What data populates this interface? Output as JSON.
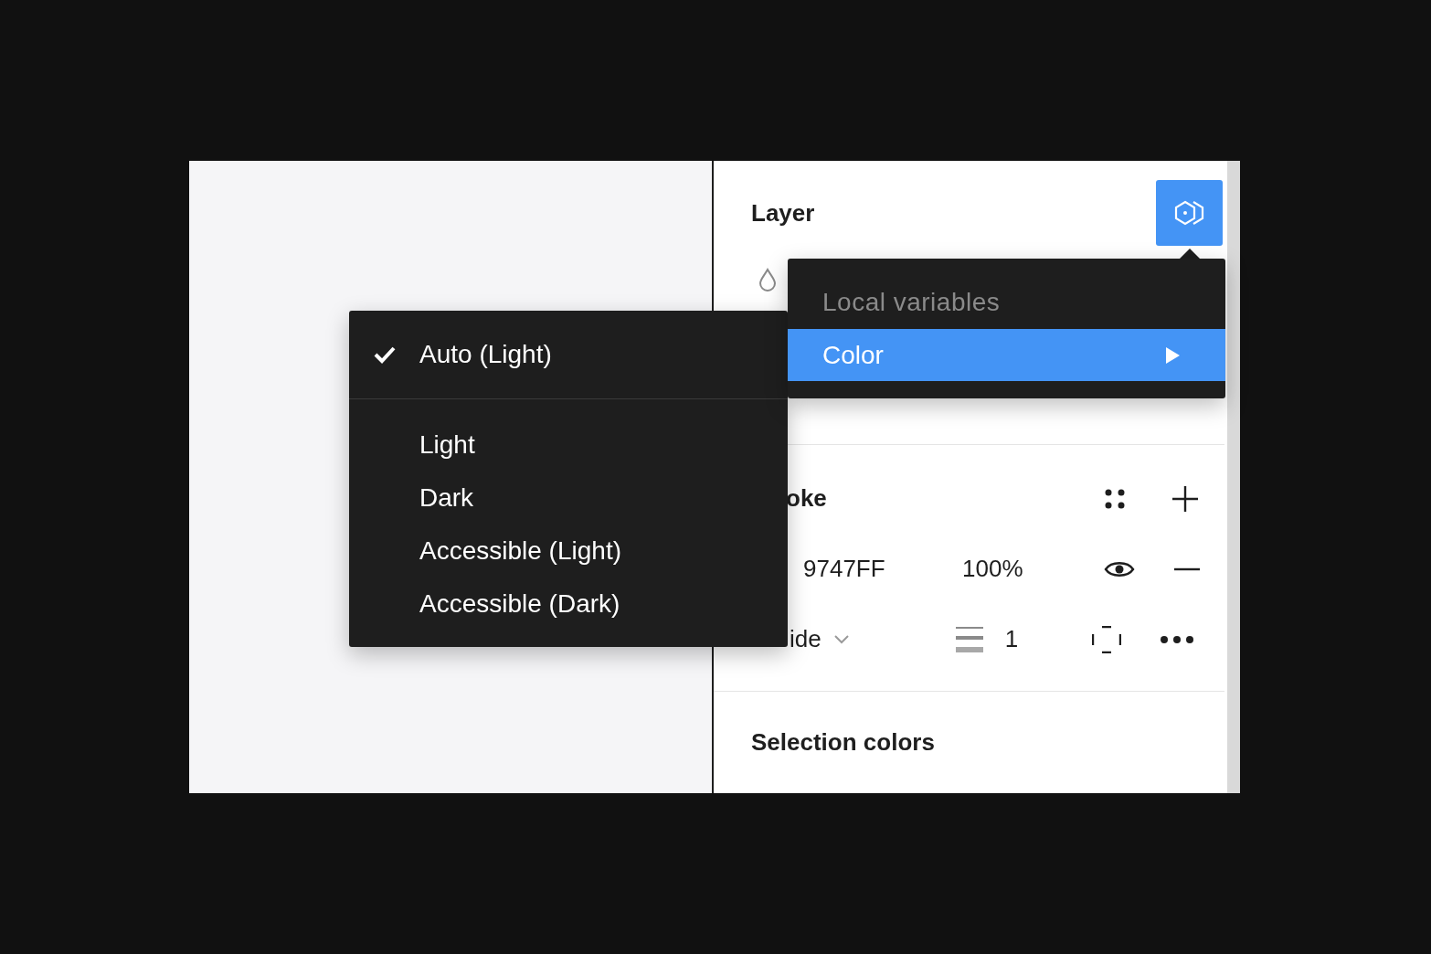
{
  "panel": {
    "layer_title": "Layer",
    "stroke_header": "oke",
    "stroke_color": {
      "hex": "9747FF",
      "opacity": "100%"
    },
    "stroke_side": {
      "position": "ide",
      "weight": "1"
    },
    "selection_colors_title": "Selection colors"
  },
  "mode_menu": {
    "items": [
      {
        "label": "Auto (Light)",
        "selected": true
      },
      {
        "label": "Light",
        "selected": false
      },
      {
        "label": "Dark",
        "selected": false
      },
      {
        "label": "Accessible (Light)",
        "selected": false
      },
      {
        "label": "Accessible (Dark)",
        "selected": false
      }
    ]
  },
  "variables_menu": {
    "header": "Local variables",
    "items": [
      {
        "label": "Color",
        "selected": true,
        "submenu": true
      }
    ]
  }
}
